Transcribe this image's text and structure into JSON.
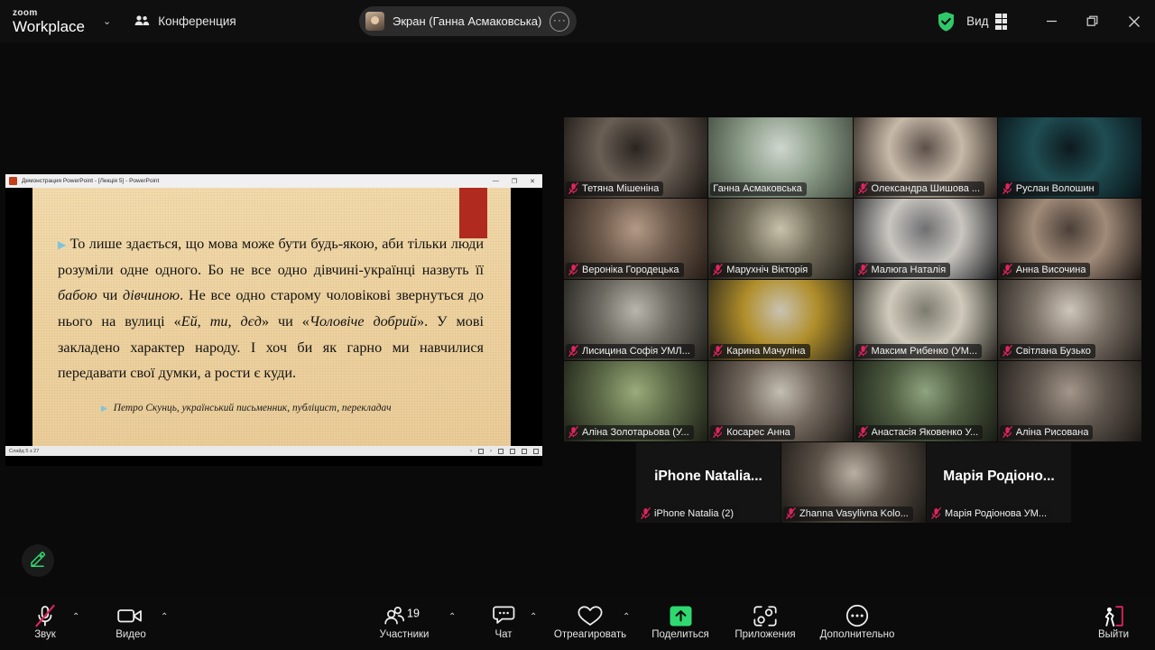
{
  "titlebar": {
    "logo_top": "zoom",
    "logo_bottom": "Workplace",
    "caret": "⌄",
    "meeting_label": "Конференция",
    "share_label": "Экран (Ганна Асмаковська)",
    "share_more": "···",
    "view_label": "Вид",
    "minimize": "—",
    "restore": "❐",
    "close": "✕",
    "shield_color": "#2fc96a",
    "accent_green": "#2fd96f"
  },
  "shared_window": {
    "title": "Демонстрация PowerPoint  -  [Лекція 5] - PowerPoint",
    "min": "—",
    "restore": "❐",
    "close": "✕",
    "status_slide": "Слайд 5 з 27",
    "slide": {
      "bullet": "▶",
      "paragraph_parts": [
        {
          "t": "То лише здається, що мова може бути будь-якою, аби тільки люди розуміли одне одного. Бо не все одно дівчині-українці назвуть її ",
          "i": false
        },
        {
          "t": "бабою",
          "i": true
        },
        {
          "t": " чи ",
          "i": false
        },
        {
          "t": "дівчиною",
          "i": true
        },
        {
          "t": ". Не все одно старому чоловікові звернуться до нього на вулиці «",
          "i": false
        },
        {
          "t": "Ей, ти, дєд",
          "i": true
        },
        {
          "t": "» чи «",
          "i": false
        },
        {
          "t": "Чоловіче добрий",
          "i": true
        },
        {
          "t": "». У мові закладено характер народу. І хоч би як гарно ми навчилися передавати свої думки, а рости є куди.",
          "i": false
        }
      ],
      "attribution": "Петро Скунць, український письменник, публіцист, перекладач"
    }
  },
  "annotate": {
    "icon": "pencil-icon",
    "color": "#2fd96f"
  },
  "grid": {
    "rows": [
      [
        {
          "name": "Тетяна Мішеніна",
          "muted": true,
          "active": false,
          "video": true,
          "tone": "t-a"
        },
        {
          "name": "Ганна Асмаковська",
          "muted": false,
          "active": true,
          "video": true,
          "tone": "t-b"
        },
        {
          "name": "Олександра Шишова ...",
          "muted": true,
          "active": false,
          "video": true,
          "tone": "t-c"
        },
        {
          "name": "Руслан Волошин",
          "muted": true,
          "active": false,
          "video": true,
          "tone": "t-d"
        }
      ],
      [
        {
          "name": "Вероніка Городецька",
          "muted": true,
          "active": false,
          "video": true,
          "tone": "t-e"
        },
        {
          "name": "Марухніч Вікторія",
          "muted": true,
          "active": false,
          "video": true,
          "tone": "t-f"
        },
        {
          "name": "Малюга Наталія",
          "muted": true,
          "active": false,
          "video": true,
          "tone": "t-g"
        },
        {
          "name": "Анна Височина",
          "muted": true,
          "active": false,
          "video": true,
          "tone": "t-h"
        }
      ],
      [
        {
          "name": "Лисицина Софія УМЛ...",
          "muted": true,
          "active": false,
          "video": true,
          "tone": "t-i"
        },
        {
          "name": "Карина Мачуліна",
          "muted": true,
          "active": false,
          "video": true,
          "tone": "t-j"
        },
        {
          "name": "Максим Рибенко (УМ...",
          "muted": true,
          "active": false,
          "video": true,
          "tone": "t-k"
        },
        {
          "name": "Світлана Бузько",
          "muted": true,
          "active": false,
          "video": true,
          "tone": "t-l"
        }
      ],
      [
        {
          "name": "Аліна Золотарьова (У...",
          "muted": true,
          "active": false,
          "video": true,
          "tone": "t-m"
        },
        {
          "name": "Косарес Анна",
          "muted": true,
          "active": false,
          "video": true,
          "tone": "t-n"
        },
        {
          "name": "Анастасія Яковенко У...",
          "muted": true,
          "active": false,
          "video": true,
          "tone": "t-o"
        },
        {
          "name": "Аліна Рисована",
          "muted": true,
          "active": false,
          "video": true,
          "tone": "t-p"
        }
      ]
    ],
    "bottom_row": [
      {
        "name": "iPhone Natalia (2)",
        "placeholder": "iPhone Natalia...",
        "muted": true,
        "video": false
      },
      {
        "name": "Zhanna Vasylivna Kolo...",
        "placeholder": "",
        "muted": true,
        "video": true,
        "tone": "t-q"
      },
      {
        "name": "Марія Родіонова УМ...",
        "placeholder": "Марія Родіоно...",
        "muted": true,
        "video": false
      }
    ]
  },
  "toolbar": {
    "audio": {
      "label": "Звук",
      "icon": "microphone-muted-icon",
      "muted": true
    },
    "video": {
      "label": "Видео",
      "icon": "camera-icon"
    },
    "participants": {
      "label": "Участники",
      "icon": "people-icon",
      "count": "19"
    },
    "chat": {
      "label": "Чат",
      "icon": "chat-bubble-icon"
    },
    "reactions": {
      "label": "Отреагировать",
      "icon": "heart-icon"
    },
    "share": {
      "label": "Поделиться",
      "icon": "share-arrow-up-icon",
      "color": "#2fd96f"
    },
    "apps": {
      "label": "Приложения",
      "icon": "apps-icon"
    },
    "more": {
      "label": "Дополнительно",
      "icon": "ellipsis-circle-icon"
    },
    "leave": {
      "label": "Выйти",
      "icon": "leave-door-icon",
      "color": "#e0245e"
    },
    "chevron": "⌃"
  }
}
